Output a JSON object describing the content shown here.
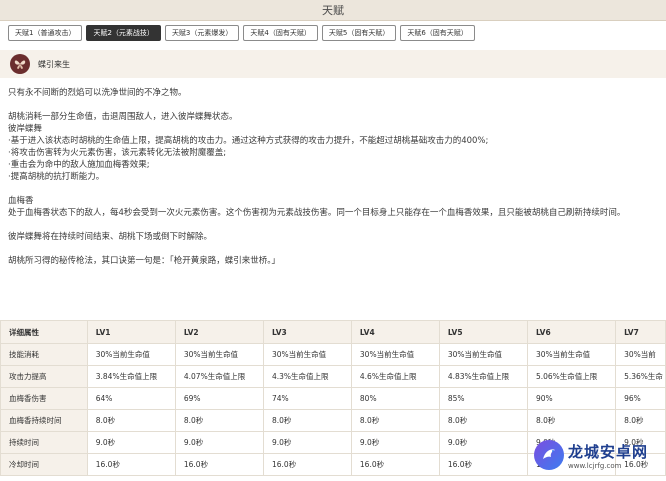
{
  "page": {
    "title": "天赋"
  },
  "tabs": [
    {
      "label": "天赋1（普通攻击）",
      "active": false
    },
    {
      "label": "天赋2（元素战技）",
      "active": true
    },
    {
      "label": "天赋3（元素爆发）",
      "active": false
    },
    {
      "label": "天赋4（固有天赋）",
      "active": false
    },
    {
      "label": "天赋5（固有天赋）",
      "active": false
    },
    {
      "label": "天赋6（固有天赋）",
      "active": false
    }
  ],
  "skill": {
    "name": "蝶引来生",
    "icon": "butterfly-icon"
  },
  "description": {
    "flavor": "只有永不间断的烈焰可以洗净世间的不净之物。",
    "effect_intro": "胡桃消耗一部分生命值，击退周围敌人，进入彼岸蝶舞状态。",
    "state_name": "彼岸蝶舞",
    "state_lines": [
      "·基于进入该状态时胡桃的生命值上限，提高胡桃的攻击力。通过这种方式获得的攻击力提升，不能超过胡桃基础攻击力的400%;",
      "·将攻击伤害转为火元素伤害，该元素转化无法被附魔覆盖;",
      "·重击会为命中的敌人施加血梅香效果;",
      "·提高胡桃的抗打断能力。"
    ],
    "blood_name": "血梅香",
    "blood_text": "处于血梅香状态下的敌人，每4秒会受到一次火元素伤害。这个伤害视为元素战技伤害。同一个目标身上只能存在一个血梅香效果，且只能被胡桃自己刷新持续时间。",
    "end_text": "彼岸蝶舞将在持续时间结束、胡桃下场或倒下时解除。",
    "lore_text": "胡桃所习得的秘传枪法，其口诀第一句是：「枪开黄泉路，蝶引来世桥。」"
  },
  "table": {
    "headers": [
      "详细属性",
      "LV1",
      "LV2",
      "LV3",
      "LV4",
      "LV5",
      "LV6",
      "LV7"
    ],
    "rows": [
      [
        "技能消耗",
        "30%当前生命值",
        "30%当前生命值",
        "30%当前生命值",
        "30%当前生命值",
        "30%当前生命值",
        "30%当前生命值",
        "30%当前"
      ],
      [
        "攻击力提高",
        "3.84%生命值上限",
        "4.07%生命值上限",
        "4.3%生命值上限",
        "4.6%生命值上限",
        "4.83%生命值上限",
        "5.06%生命值上限",
        "5.36%生命"
      ],
      [
        "血梅香伤害",
        "64%",
        "69%",
        "74%",
        "80%",
        "85%",
        "90%",
        "96%"
      ],
      [
        "血梅香持续时间",
        "8.0秒",
        "8.0秒",
        "8.0秒",
        "8.0秒",
        "8.0秒",
        "8.0秒",
        "8.0秒"
      ],
      [
        "持续时间",
        "9.0秒",
        "9.0秒",
        "9.0秒",
        "9.0秒",
        "9.0秒",
        "9.0秒",
        "9.0秒"
      ],
      [
        "冷却时间",
        "16.0秒",
        "16.0秒",
        "16.0秒",
        "16.0秒",
        "16.0秒",
        "16.0秒",
        "16.0秒"
      ]
    ]
  },
  "watermark": {
    "title": "龙城安卓网",
    "url": "www.lcjrfg.com",
    "icon": "dragon-logo-icon"
  },
  "colors": {
    "active_tab": "#333333",
    "header_bg": "#f6f1ea",
    "title_bg": "#ece6dc",
    "skill_icon": "#6b2d2d"
  }
}
